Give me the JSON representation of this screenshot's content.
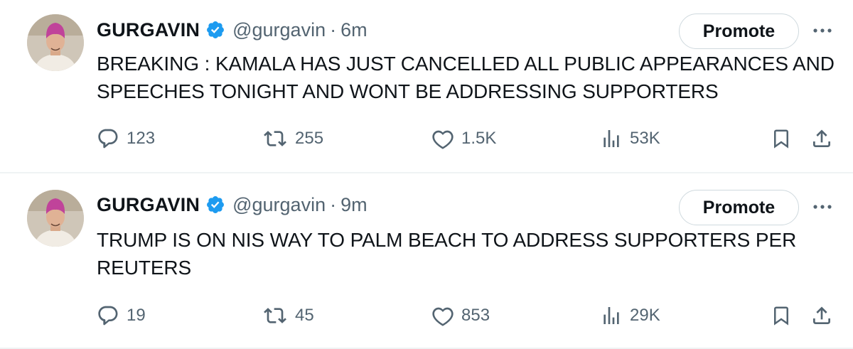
{
  "tweets": [
    {
      "display_name": "GURGAVIN",
      "handle": "@gurgavin",
      "separator": "·",
      "time": "6m",
      "promote_label": "Promote",
      "text": "BREAKING : KAMALA HAS JUST CANCELLED ALL PUBLIC APPEARANCES AND SPEECHES TONIGHT AND WONT BE ADDRESSING SUPPORTERS",
      "replies": "123",
      "retweets": "255",
      "likes": "1.5K",
      "views": "53K"
    },
    {
      "display_name": "GURGAVIN",
      "handle": "@gurgavin",
      "separator": "·",
      "time": "9m",
      "promote_label": "Promote",
      "text": "TRUMP IS ON NIS WAY TO PALM BEACH TO ADDRESS SUPPORTERS PER REUTERS",
      "replies": "19",
      "retweets": "45",
      "likes": "853",
      "views": "29K"
    }
  ],
  "icons": {
    "verified": "verified-badge-icon",
    "more": "more-options-icon",
    "reply": "reply-icon",
    "retweet": "retweet-icon",
    "like": "heart-icon",
    "views": "views-icon",
    "bookmark": "bookmark-icon",
    "share": "share-icon"
  },
  "colors": {
    "verified_blue": "#1d9bf0",
    "text_primary": "#0f1419",
    "text_secondary": "#536471",
    "divider": "#eff3f4",
    "avatar_cap": "#c0439a"
  }
}
